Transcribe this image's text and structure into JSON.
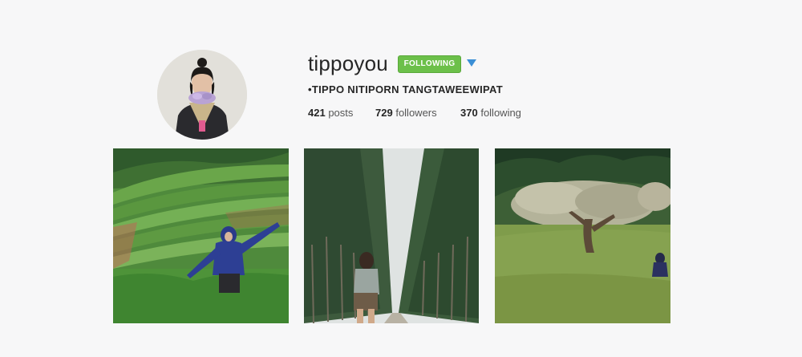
{
  "profile": {
    "username": "tippoyou",
    "follow_button_label": "FOLLOWING",
    "full_name": "•TIPPO NITIPORN TANGTAWEEWIPAT",
    "stats": {
      "posts_count": "421",
      "posts_label": "posts",
      "followers_count": "729",
      "followers_label": "followers",
      "following_count": "370",
      "following_label": "following"
    }
  },
  "icons": {
    "dropdown": "caret-down-icon"
  },
  "colors": {
    "background": "#f7f7f8",
    "follow_button": "#6cc04a",
    "dropdown_arrow": "#3b8fd6"
  }
}
